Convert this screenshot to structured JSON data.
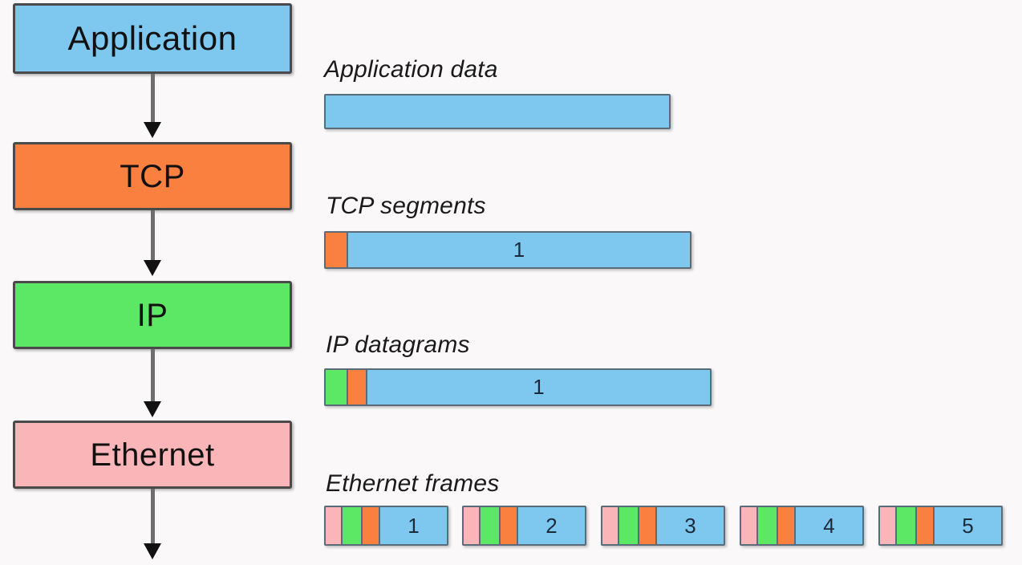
{
  "colors": {
    "background": "#faf8f8",
    "application_blue": "#7ec8f0",
    "tcp_orange": "#fa8040",
    "ip_green": "#5ce865",
    "ethernet_pink": "#f9b5b8",
    "box_border": "#4a4a4a",
    "pdu_border": "#5a6b7a",
    "arrow": "#6e6e6e",
    "arrow_head": "#111111",
    "text": "#111111"
  },
  "stack": {
    "layers": [
      {
        "name": "application",
        "label": "Application",
        "color": "#7ec8f0",
        "font_size": 42
      },
      {
        "name": "tcp",
        "label": "TCP",
        "color": "#fa8040",
        "font_size": 40
      },
      {
        "name": "ip",
        "label": "IP",
        "color": "#5ce865",
        "font_size": 40
      },
      {
        "name": "ethernet",
        "label": "Ethernet",
        "color": "#f9b5b8",
        "font_size": 40
      }
    ]
  },
  "pdus": [
    {
      "name": "application-data",
      "label": "Application data",
      "segments": [
        {
          "kind": "payload",
          "color": "#7ec8f0",
          "text": ""
        }
      ]
    },
    {
      "name": "tcp-segments",
      "label": "TCP segments",
      "segments": [
        {
          "kind": "tcp-header",
          "color": "#fa8040",
          "text": ""
        },
        {
          "kind": "payload",
          "color": "#7ec8f0",
          "text": "1"
        }
      ]
    },
    {
      "name": "ip-datagrams",
      "label": "IP datagrams",
      "segments": [
        {
          "kind": "ip-header",
          "color": "#5ce865",
          "text": ""
        },
        {
          "kind": "tcp-header",
          "color": "#fa8040",
          "text": ""
        },
        {
          "kind": "payload",
          "color": "#7ec8f0",
          "text": "1"
        }
      ]
    },
    {
      "name": "ethernet-frames",
      "label": "Ethernet frames",
      "frames": [
        {
          "number": "1"
        },
        {
          "number": "2"
        },
        {
          "number": "3"
        },
        {
          "number": "4"
        },
        {
          "number": "5"
        }
      ],
      "frame_segments": [
        {
          "kind": "ethernet-header",
          "color": "#f9b5b8"
        },
        {
          "kind": "ip-header",
          "color": "#5ce865"
        },
        {
          "kind": "tcp-header",
          "color": "#fa8040"
        },
        {
          "kind": "payload",
          "color": "#7ec8f0"
        }
      ]
    }
  ]
}
